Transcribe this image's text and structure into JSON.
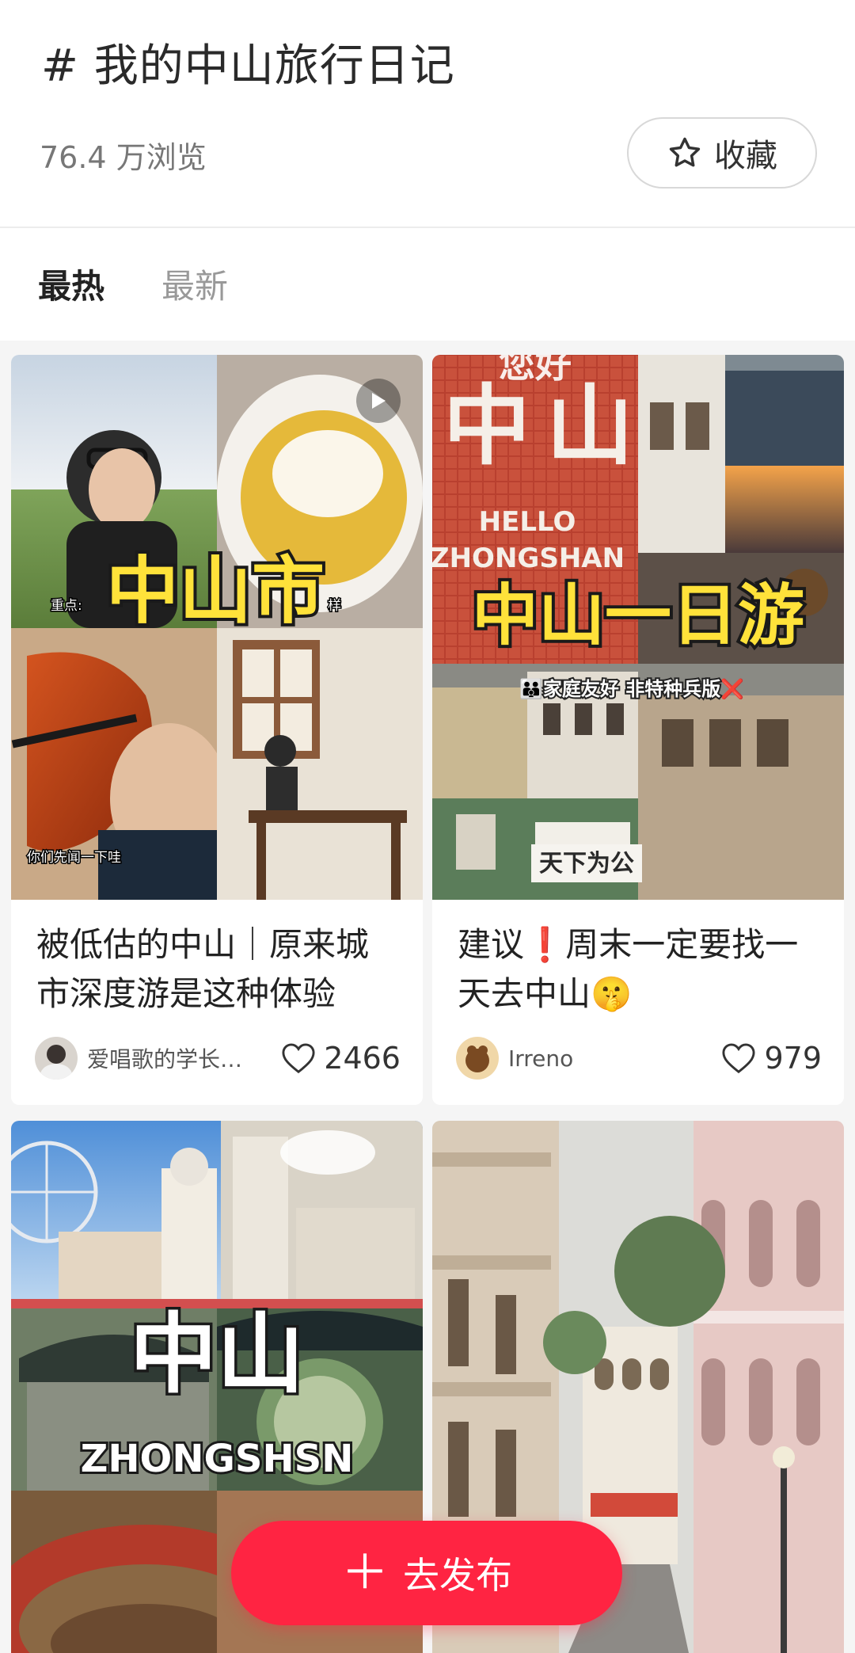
{
  "header": {
    "topic_title": "# 我的中山旅行日记",
    "views": "76.4 万浏览",
    "favorite_label": "收藏"
  },
  "tabs": [
    {
      "label": "最热",
      "active": true
    },
    {
      "label": "最新",
      "active": false
    }
  ],
  "posts": [
    {
      "title": "被低估的中山｜原来城市深度游是这种体验",
      "image_text": "中山市",
      "caption_left": "重点:",
      "caption_right": "样",
      "subtitle": "你们先闻一下哇",
      "author": "爱唱歌的学长…",
      "likes": "2466",
      "is_video": true
    },
    {
      "title": "建议❗周末一定要找一天去中山🤫",
      "image_text_top": "中山",
      "image_hello": "HELLO",
      "image_city": "ZHONGSHAN",
      "image_text": "中山一日游",
      "image_tags": "👪家庭友好  非特种兵版❌",
      "image_sign": "天下为公",
      "author": "Irreno",
      "likes": "979",
      "is_video": false
    },
    {
      "image_text": "中山",
      "image_subtitle": "ZHONGSHSN"
    },
    {
      "image_text": ""
    }
  ],
  "publish": {
    "label": "去发布"
  },
  "colors": {
    "accent": "#ff2442",
    "title_yellow": "#ffe23a"
  }
}
